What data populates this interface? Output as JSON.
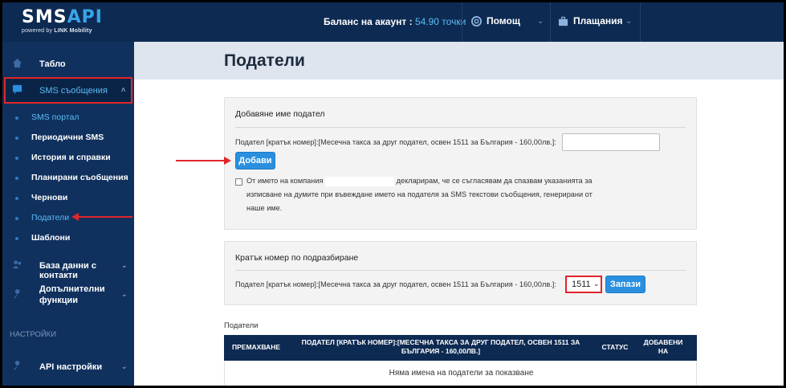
{
  "header": {
    "logo_main": "SMS",
    "logo_api": "API",
    "logo_sub_prefix": "powered by",
    "logo_sub_brand": "LINK Mobility",
    "balance_label": "Баланс на акаунт :",
    "balance_value": "54.90 точки",
    "help_label": "Помощ",
    "payments_label": "Плащания"
  },
  "sidebar": {
    "dashboard": "Табло",
    "sms": "SMS съобщения",
    "sub_items": [
      "SMS портал",
      "Периодични SMS",
      "История и справки",
      "Планирани съобщения",
      "Чернови",
      "Податели",
      "Шаблони"
    ],
    "contacts": "База данни с контакти",
    "extra_line1": "Допълнителни",
    "extra_line2": "функции",
    "settings_section": "НАСТРОЙКИ",
    "api_settings": "API настройки"
  },
  "main": {
    "title": "Подател­и",
    "add_panel": {
      "title": "Добавяне име подател",
      "field_label": "Подател [кратък номер]:[Месечна такса за друг подател, освен 1511 за България - 160,00лв.]:",
      "add_button": "Добави",
      "decl_part1": "От името на компания",
      "decl_part2": "декларирам, че се съгласявам да спазвам указанията за изписване на думите при въвеждане името на подателя за SMS текстови съобщения, генерирани от наше име."
    },
    "default_panel": {
      "title": "Кратък номер по подразбиране",
      "field_label": "Подател [кратък номер]:[Месечна такса за друг подател, освен 1511 за България - 160,00лв.]:",
      "selected": "1511",
      "save_button": "Запази"
    },
    "table": {
      "caption": "Подател­и",
      "headers": [
        "ПРЕМАХВАНЕ",
        "ПОДАТЕЛ [КРАТЪК НОМЕР]:[МЕСЕЧНА ТАКСА ЗА ДРУГ ПОДАТЕЛ, ОСВЕН 1511 ЗА БЪЛГАРИЯ - 160,00ЛВ.]",
        "СТАТУС",
        "ДОБАВЕНИ НА"
      ],
      "empty_message": "Няма имена на податели за показване"
    }
  },
  "colors": {
    "header_bg": "#0d2a52",
    "sidebar_bg": "#10315e",
    "accent": "#2a8fdf",
    "highlight": "#e0262a",
    "link": "#5cbcf5"
  }
}
